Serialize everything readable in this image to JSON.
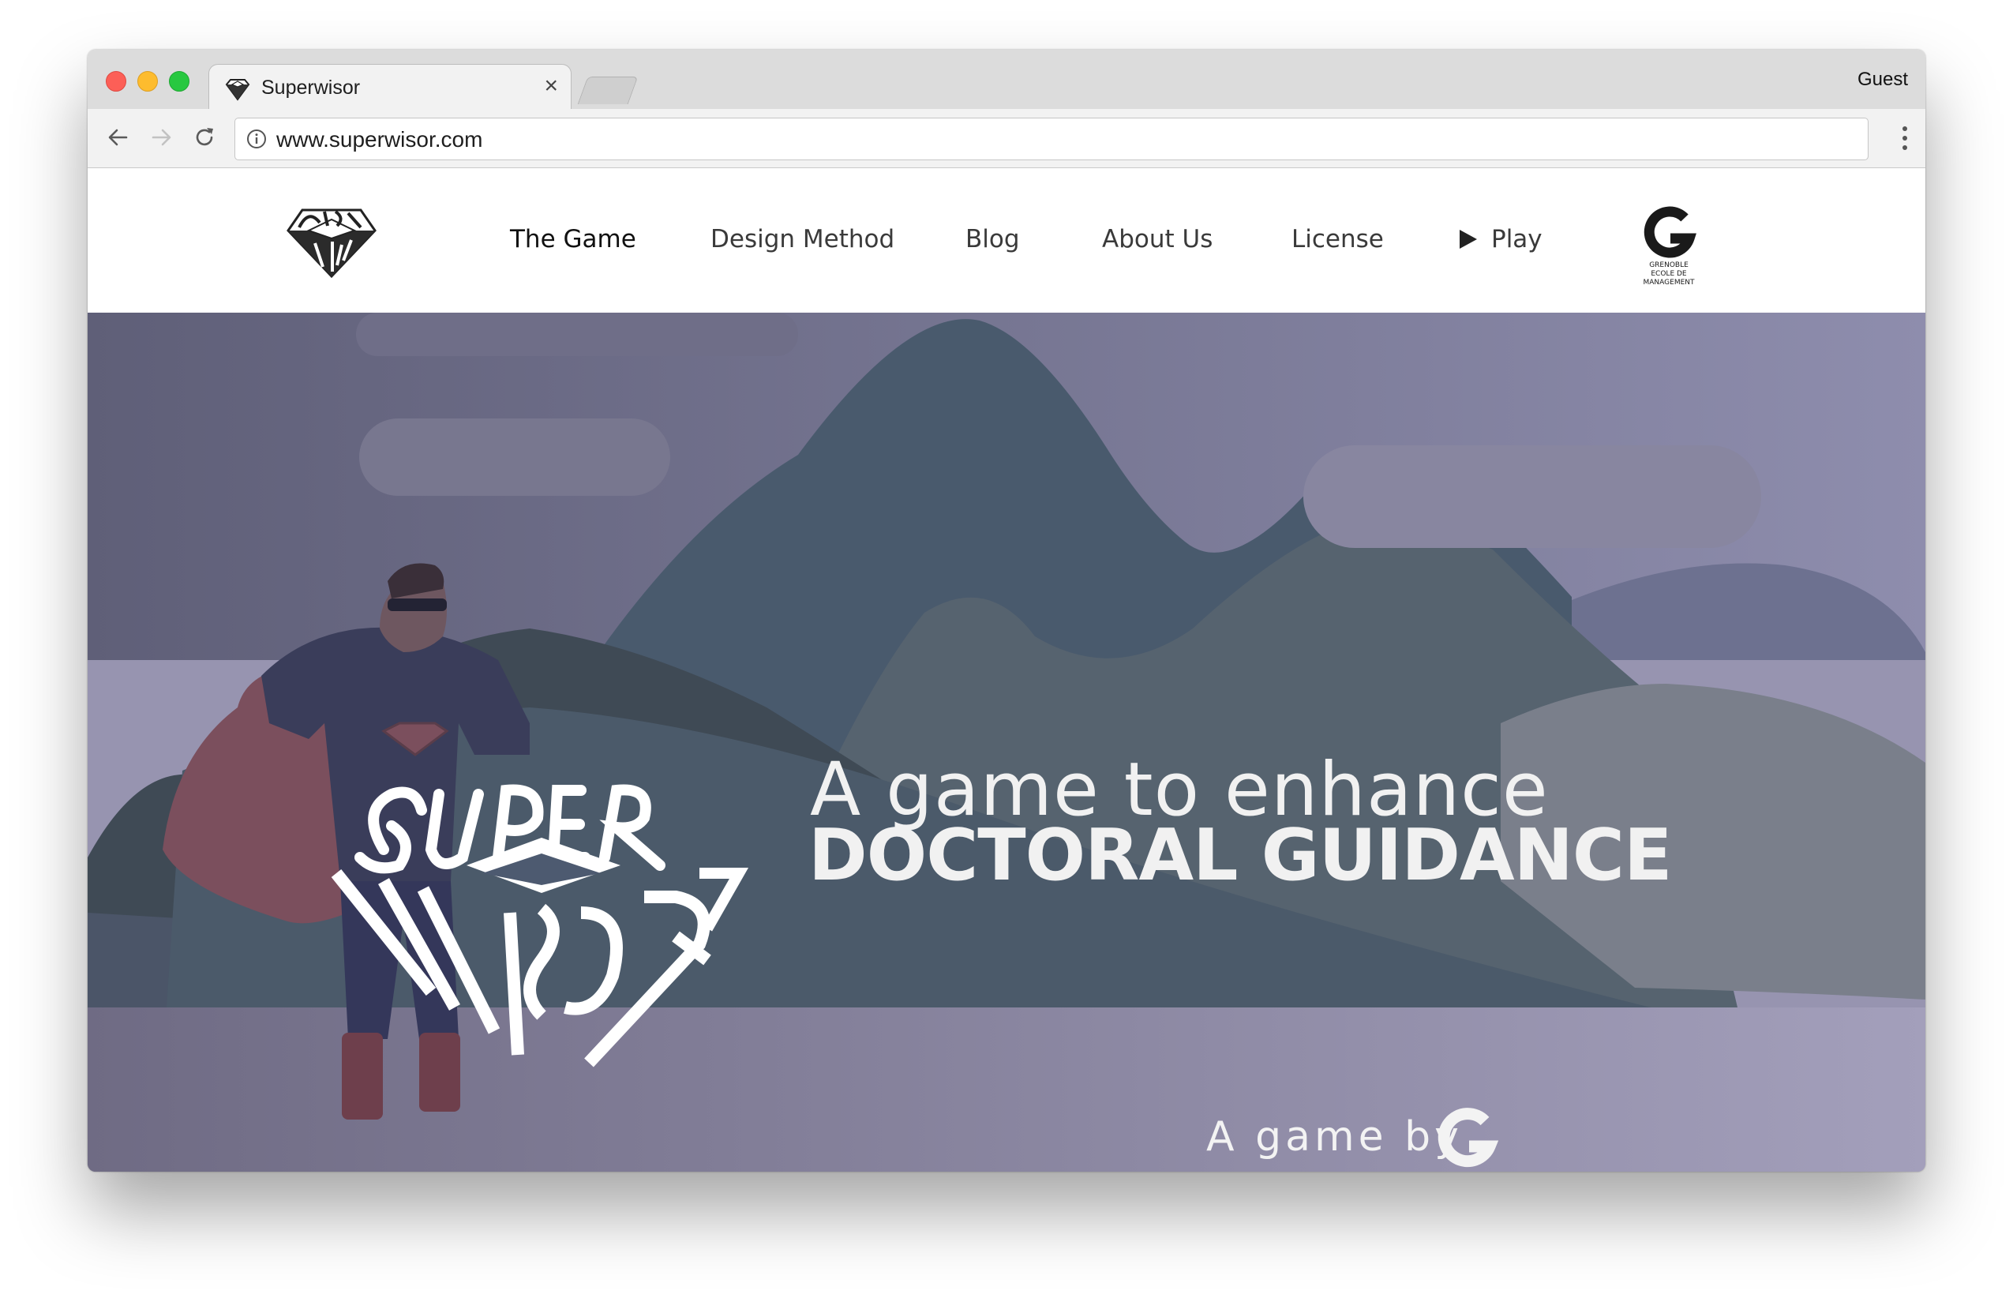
{
  "browser": {
    "tab_title": "Superwisor",
    "tab_close": "×",
    "profile": "Guest",
    "url": "www.superwisor.com"
  },
  "nav": {
    "items": [
      "The Game",
      "Design Method",
      "Blog",
      "About Us",
      "License",
      "Play"
    ],
    "active_index": 0,
    "partner_logo_text": [
      "GRENOBLE",
      "ECOLE DE",
      "MANAGEMENT"
    ]
  },
  "hero": {
    "logo_words": [
      "SUPER",
      "WISOR"
    ],
    "tagline_line1": "A game to enhance",
    "tagline_line2": "DOCTORAL GUIDANCE",
    "footer_text": "A game by"
  },
  "colors": {
    "accent": "#4b1f8e",
    "hero_text": "#f1f1f1",
    "hero_overlay": "#6d6b8c"
  }
}
